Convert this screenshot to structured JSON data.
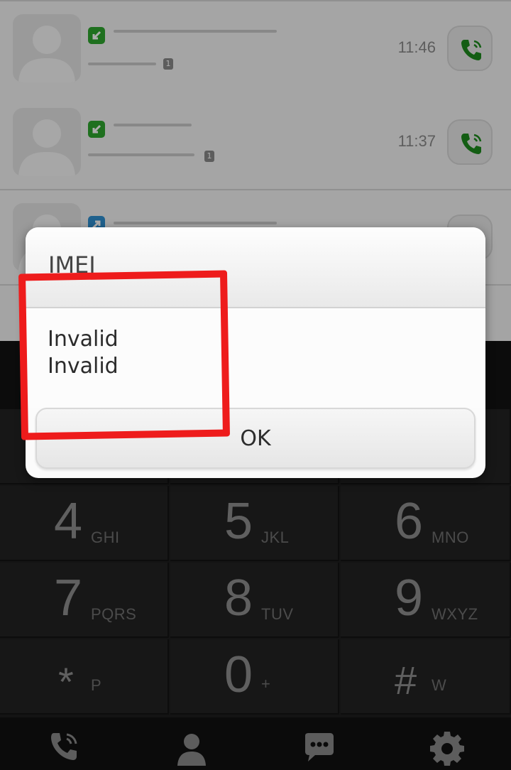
{
  "colors": {
    "highlight": "#ee1c1c",
    "incoming": "#2ea52e",
    "outgoing": "#2f8fd0",
    "call_icon": "#1d8a1d"
  },
  "call_log": {
    "rows": [
      {
        "type_icon": "incoming-call-icon",
        "sim": "1",
        "time": "11:46"
      },
      {
        "type_icon": "incoming-call-icon",
        "sim": "1",
        "time": "11:37"
      },
      {
        "type_icon": "outgoing-call-icon",
        "sim": "",
        "time": ""
      }
    ]
  },
  "dialpad": {
    "keys": [
      {
        "digit": "4",
        "letters": "GHI"
      },
      {
        "digit": "5",
        "letters": "JKL"
      },
      {
        "digit": "6",
        "letters": "MNO"
      },
      {
        "digit": "7",
        "letters": "PQRS"
      },
      {
        "digit": "8",
        "letters": "TUV"
      },
      {
        "digit": "9",
        "letters": "WXYZ"
      },
      {
        "digit": "*",
        "letters": "P"
      },
      {
        "digit": "0",
        "letters": "+"
      },
      {
        "digit": "#",
        "letters": "W"
      }
    ]
  },
  "bottom_tabs": [
    "phone-icon",
    "contacts-icon",
    "messages-icon",
    "settings-icon"
  ],
  "dialog": {
    "title": "IMEI",
    "lines": [
      "Invalid",
      "Invalid"
    ],
    "ok_label": "OK"
  }
}
